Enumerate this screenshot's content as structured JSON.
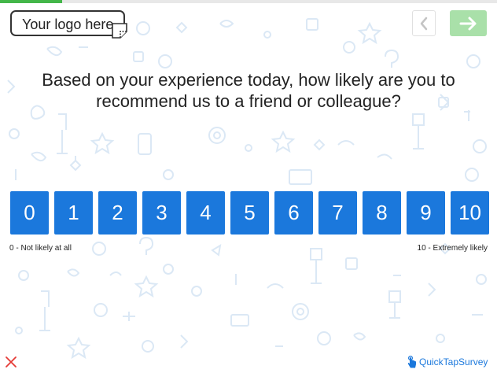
{
  "progress": {
    "fraction": 0.125,
    "color": "#43b649"
  },
  "logo": {
    "text": "Your logo here",
    "icon": "edit-sticker-icon"
  },
  "navigation": {
    "back_icon": "chevron-left-icon",
    "next_icon": "arrow-right-icon",
    "next_color": "#a9e0a9"
  },
  "question": {
    "line1": "Based on your experience today, how likely are you to",
    "line2": "recommend us to a friend or colleague?"
  },
  "scale": {
    "options": [
      "0",
      "1",
      "2",
      "3",
      "4",
      "5",
      "6",
      "7",
      "8",
      "9",
      "10"
    ],
    "button_color": "#1b78dc",
    "low_label": "0 - Not likely at all",
    "high_label": "10 - Extremely likely"
  },
  "footer": {
    "exit_icon": "close-icon",
    "exit_color": "#e53935",
    "brand_text": "QuickTapSurvey",
    "brand_icon": "tap-hand-icon",
    "brand_color": "#1b78dc"
  },
  "background": {
    "pattern_color": "#dbe8f5"
  }
}
